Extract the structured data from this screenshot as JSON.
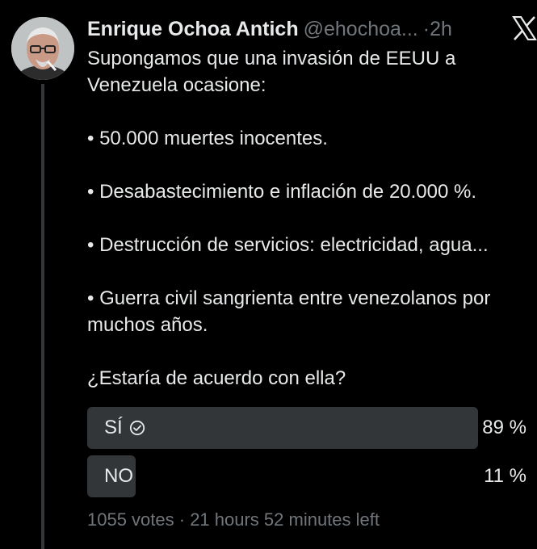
{
  "tweet": {
    "author_name": "Enrique Ochoa Antich",
    "handle": "@ehochoa...",
    "separator": "·",
    "time_ago": "2h",
    "body": {
      "intro": "Supongamos que una invasión de EEUU a Venezuela ocasione:",
      "bullets": [
        "• 50.000 muertes inocentes.",
        "• Desabastecimiento e inflación de 20.000 %.",
        "• Destrucción de servicios: electricidad, agua...",
        "• Guerra civil sangrienta entre venezolanos por muchos años."
      ],
      "question": "¿Estaría de acuerdo con ella?"
    }
  },
  "poll": {
    "options": [
      {
        "label": "SÍ",
        "percent_label": "89 %",
        "percent": 89,
        "selected": true
      },
      {
        "label": "NO",
        "percent_label": "11 %",
        "percent": 11,
        "selected": false
      }
    ],
    "footer": "1055 votes · 21 hours 52 minutes left"
  },
  "icons": {
    "brand": "x-logo-icon",
    "winner": "check-circle-icon"
  },
  "colors": {
    "background": "#000000",
    "text_primary": "#e7e9ea",
    "text_secondary": "#71767b",
    "poll_bar": "#333639",
    "thread_line": "#333639"
  }
}
